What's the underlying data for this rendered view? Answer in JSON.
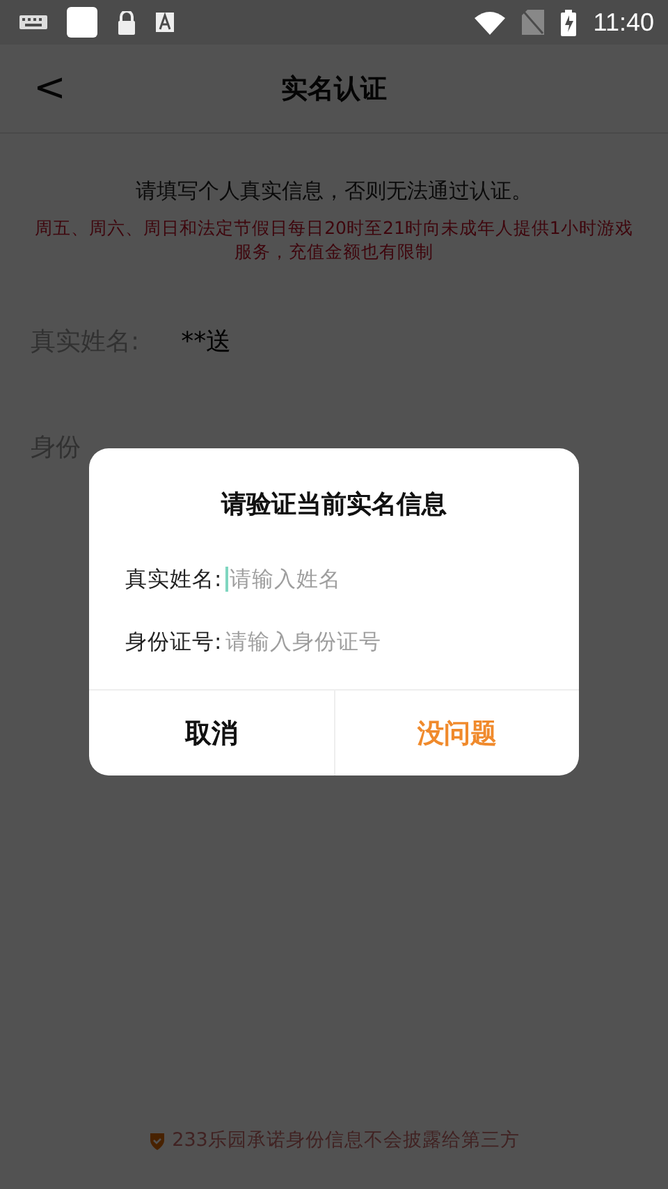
{
  "status_bar": {
    "time": "11:40"
  },
  "header": {
    "back": "<",
    "title": "实名认证"
  },
  "notice": "请填写个人真实信息，否则无法通过认证。",
  "warning": "周五、周六、周日和法定节假日每日20时至21时向未成年人提供1小时游戏服务，充值金额也有限制",
  "form": [
    {
      "label": "真实姓名:",
      "value": "**送"
    },
    {
      "label": "身份"
    }
  ],
  "footer": "233乐园承诺身份信息不会披露给第三方",
  "dialog": {
    "title": "请验证当前实名信息",
    "fields": [
      {
        "label": "真实姓名:",
        "placeholder": "请输入姓名",
        "focused": true
      },
      {
        "label": "身份证号:",
        "placeholder": "请输入身份证号",
        "focused": false
      }
    ],
    "buttons": [
      {
        "label": "取消",
        "kind": "cancel"
      },
      {
        "label": "没问题",
        "kind": "confirm"
      }
    ]
  }
}
